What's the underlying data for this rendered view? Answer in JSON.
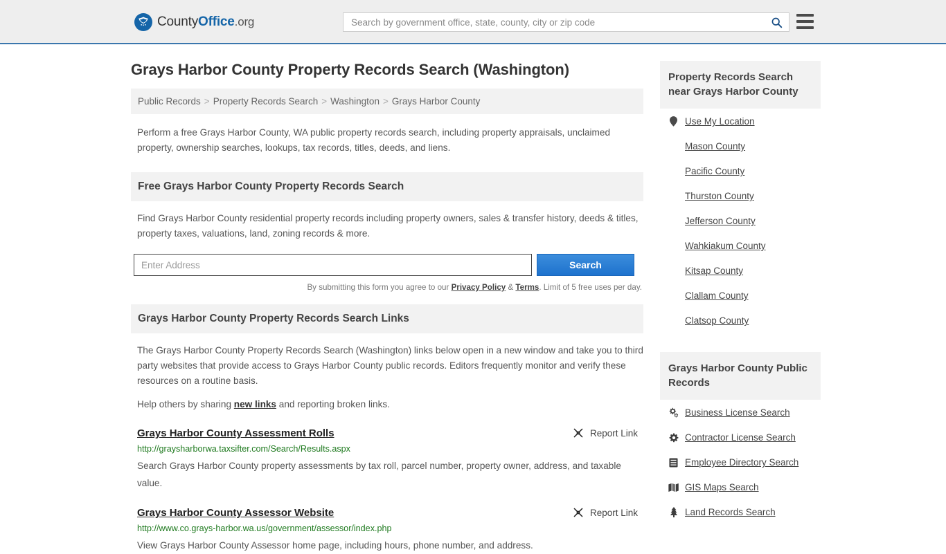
{
  "header": {
    "brand": {
      "part1": "County",
      "part2": "Office",
      "part3": ".org",
      "logo_icon": "eagle-shield-logo"
    },
    "search_placeholder": "Search by government office, state, county, city or zip code",
    "search_value": "",
    "search_icon": "search-icon",
    "menu_icon": "hamburger-menu-icon"
  },
  "page": {
    "title": "Grays Harbor County Property Records Search (Washington)",
    "breadcrumb": [
      "Public Records",
      "Property Records Search",
      "Washington",
      "Grays Harbor County"
    ],
    "breadcrumb_separator": ">",
    "intro": "Perform a free Grays Harbor County, WA public property records search, including property appraisals, unclaimed property, ownership searches, lookups, tax records, titles, deeds, and liens."
  },
  "free_search": {
    "heading": "Free Grays Harbor County Property Records Search",
    "description": "Find Grays Harbor County residential property records including property owners, sales & transfer history, deeds & titles, property taxes, valuations, land, zoning records & more.",
    "input_placeholder": "Enter Address",
    "input_value": "",
    "button_label": "Search",
    "legal_prefix": "By submitting this form you agree to our ",
    "legal_privacy": "Privacy Policy",
    "legal_amp": " & ",
    "legal_terms": "Terms",
    "legal_suffix": ". Limit of 5 free uses per day."
  },
  "links_section": {
    "heading": "Grays Harbor County Property Records Search Links",
    "description": "The Grays Harbor County Property Records Search (Washington) links below open in a new window and take you to third party websites that provide access to Grays Harbor County public records. Editors frequently monitor and verify these resources on a routine basis.",
    "help_prefix": "Help others by sharing ",
    "help_link": "new links",
    "help_suffix": " and reporting broken links.",
    "report_label": "Report Link",
    "report_icon": "broken-link-icon",
    "items": [
      {
        "title": "Grays Harbor County Assessment Rolls",
        "url": "http://graysharborwa.taxsifter.com/Search/Results.aspx",
        "description": "Search Grays Harbor County property assessments by tax roll, parcel number, property owner, address, and taxable value."
      },
      {
        "title": "Grays Harbor County Assessor Website",
        "url": "http://www.co.grays-harbor.wa.us/government/assessor/index.php",
        "description": "View Grays Harbor County Assessor home page, including hours, phone number, and address."
      }
    ]
  },
  "sidebar": {
    "near": {
      "heading": "Property Records Search near Grays Harbor County",
      "items": [
        {
          "label": "Use My Location",
          "icon": "map-pin-icon"
        },
        {
          "label": "Mason County",
          "icon": ""
        },
        {
          "label": "Pacific County",
          "icon": ""
        },
        {
          "label": "Thurston County",
          "icon": ""
        },
        {
          "label": "Jefferson County",
          "icon": ""
        },
        {
          "label": "Wahkiakum County",
          "icon": ""
        },
        {
          "label": "Kitsap County",
          "icon": ""
        },
        {
          "label": "Clallam County",
          "icon": ""
        },
        {
          "label": "Clatsop County",
          "icon": ""
        }
      ]
    },
    "public_records": {
      "heading": "Grays Harbor County Public Records",
      "items": [
        {
          "label": "Business License Search",
          "icon": "cogs-icon"
        },
        {
          "label": "Contractor License Search",
          "icon": "cog-icon"
        },
        {
          "label": "Employee Directory Search",
          "icon": "list-card-icon"
        },
        {
          "label": "GIS Maps Search",
          "icon": "map-icon"
        },
        {
          "label": "Land Records Search",
          "icon": "tree-icon"
        }
      ]
    }
  },
  "colors": {
    "brand_blue": "#1565a8",
    "header_border": "#3b77ad",
    "header_bg": "#eeeeee",
    "panel_bg": "#f2f2f2",
    "button_blue": "#1e72cd",
    "url_green": "#1f7a1f"
  }
}
